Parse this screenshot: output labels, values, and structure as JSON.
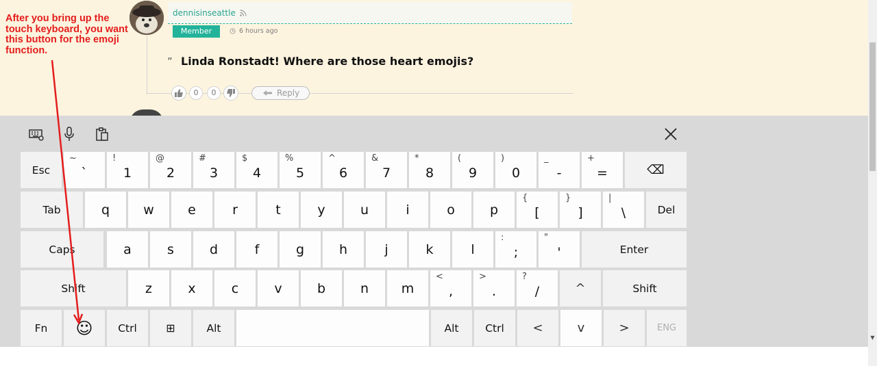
{
  "comment": {
    "username": "dennisinseattle",
    "badge": "Member",
    "time": "6 hours ago",
    "quote_mark": "”",
    "text": "Linda Ronstadt! Where are those heart emojis?",
    "upvotes": "0",
    "downvotes": "0",
    "reply_label": "Reply"
  },
  "annotation": {
    "text": "After you bring up the touch keyboard, you want this button for the emoji function."
  },
  "colors": {
    "accent": "#22b39a",
    "annotation": "#e41c1c",
    "page_bg": "#fcf4df",
    "keyboard_bg": "#d9d9d9"
  },
  "keyboard": {
    "toolbar": [
      "keyboard-settings-icon",
      "microphone-icon",
      "clipboard-icon"
    ],
    "close_icon": "close-icon",
    "rows": [
      [
        {
          "main": "Esc"
        },
        {
          "main": "`",
          "shift": "~"
        },
        {
          "main": "1",
          "shift": "!"
        },
        {
          "main": "2",
          "shift": "@"
        },
        {
          "main": "3",
          "shift": "#"
        },
        {
          "main": "4",
          "shift": "$"
        },
        {
          "main": "5",
          "shift": "%"
        },
        {
          "main": "6",
          "shift": "^"
        },
        {
          "main": "7",
          "shift": "&"
        },
        {
          "main": "8",
          "shift": "*"
        },
        {
          "main": "9",
          "shift": "("
        },
        {
          "main": "0",
          "shift": ")"
        },
        {
          "main": "-",
          "shift": "_"
        },
        {
          "main": "=",
          "shift": "+"
        },
        {
          "main": "⌫",
          "icon": "backspace-icon"
        }
      ],
      [
        {
          "main": "Tab"
        },
        {
          "main": "q"
        },
        {
          "main": "w"
        },
        {
          "main": "e"
        },
        {
          "main": "r"
        },
        {
          "main": "t"
        },
        {
          "main": "y"
        },
        {
          "main": "u"
        },
        {
          "main": "i"
        },
        {
          "main": "o"
        },
        {
          "main": "p"
        },
        {
          "main": "[",
          "shift": "{"
        },
        {
          "main": "]",
          "shift": "}"
        },
        {
          "main": "\\",
          "shift": "|"
        },
        {
          "main": "Del"
        }
      ],
      [
        {
          "main": "Caps"
        },
        {
          "main": "a"
        },
        {
          "main": "s"
        },
        {
          "main": "d"
        },
        {
          "main": "f"
        },
        {
          "main": "g"
        },
        {
          "main": "h"
        },
        {
          "main": "j"
        },
        {
          "main": "k"
        },
        {
          "main": "l"
        },
        {
          "main": ";",
          "shift": ":"
        },
        {
          "main": "'",
          "shift": "\""
        },
        {
          "main": "Enter"
        }
      ],
      [
        {
          "main": "Shift"
        },
        {
          "main": "z"
        },
        {
          "main": "x"
        },
        {
          "main": "c"
        },
        {
          "main": "v"
        },
        {
          "main": "b"
        },
        {
          "main": "n"
        },
        {
          "main": "m"
        },
        {
          "main": ",",
          "shift": "<"
        },
        {
          "main": ".",
          "shift": ">"
        },
        {
          "main": "/",
          "shift": "?"
        },
        {
          "main": "^",
          "icon": "up-arrow-icon"
        },
        {
          "main": "Shift"
        }
      ],
      [
        {
          "main": "Fn"
        },
        {
          "main": "☺",
          "icon": "emoji-icon"
        },
        {
          "main": "Ctrl"
        },
        {
          "main": "⊞",
          "icon": "windows-icon"
        },
        {
          "main": "Alt"
        },
        {
          "main": "",
          "icon": "space-bar"
        },
        {
          "main": "Alt"
        },
        {
          "main": "Ctrl"
        },
        {
          "main": "<",
          "icon": "left-arrow-icon"
        },
        {
          "main": "v",
          "icon": "down-arrow-icon"
        },
        {
          "main": ">",
          "icon": "right-arrow-icon"
        },
        {
          "main": "ENG"
        }
      ]
    ]
  }
}
